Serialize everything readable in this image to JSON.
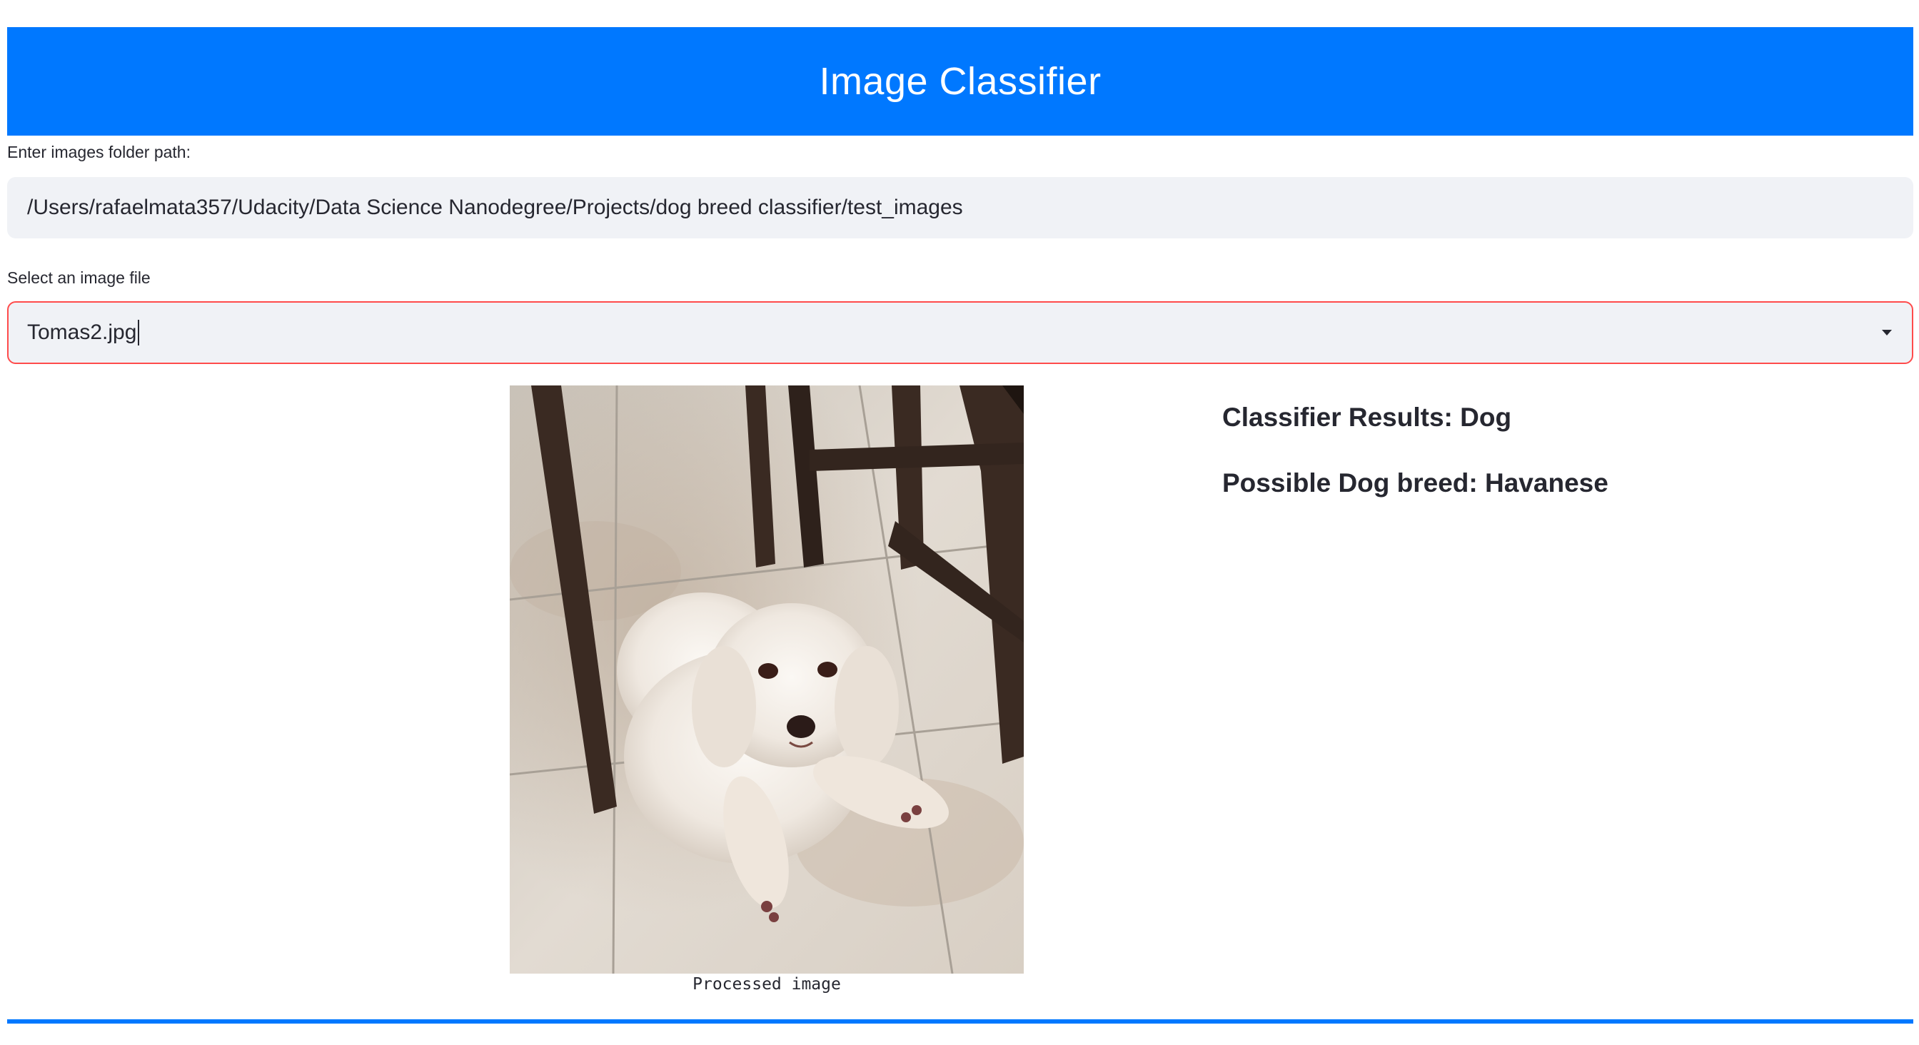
{
  "header": {
    "title": "Image Classifier",
    "color": "#0078ff"
  },
  "folder_input": {
    "label": "Enter images folder path:",
    "value": "/Users/rafaelmata357/Udacity/Data Science Nanodegree/Projects/dog breed classifier/test_images"
  },
  "file_select": {
    "label": "Select an image file",
    "value": "Tomas2.jpg",
    "border_color": "#ff4b4b",
    "icon": "chevron-down-icon"
  },
  "image": {
    "caption": "Processed image",
    "subject": "white dog lying on tiled floor under chairs"
  },
  "results": {
    "classifier": "Classifier Results: Dog",
    "breed": "Possible Dog breed: Havanese"
  }
}
